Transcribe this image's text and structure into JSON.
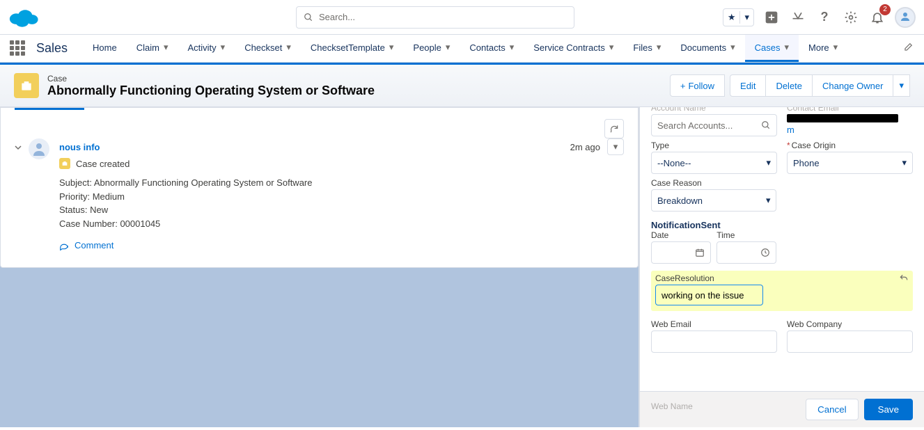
{
  "header": {
    "search_placeholder": "Search...",
    "notification_count": "2"
  },
  "nav": {
    "app_name": "Sales",
    "items": [
      "Home",
      "Claim",
      "Activity",
      "Checkset",
      "ChecksetTemplate",
      "People",
      "Contacts",
      "Service Contracts",
      "Files",
      "Documents",
      "Cases",
      "More"
    ],
    "active_index": 10
  },
  "page": {
    "record_type": "Case",
    "title": "Abnormally Functioning Operating System or Software",
    "actions": {
      "follow": "Follow",
      "edit": "Edit",
      "delete": "Delete",
      "change_owner": "Change Owner"
    }
  },
  "feed": {
    "user": "nous info",
    "time": "2m ago",
    "event": "Case created",
    "subject_label": "Subject:",
    "subject": "Abnormally Functioning Operating System or Software",
    "priority_label": "Priority:",
    "priority": "Medium",
    "status_label": "Status:",
    "status": "New",
    "casenum_label": "Case Number:",
    "casenum": "00001045",
    "comment": "Comment"
  },
  "form": {
    "account_label": "Account Name",
    "account_placeholder": "Search Accounts...",
    "contact_label": "Contact Email",
    "contact_value_suffix": "m",
    "type_label": "Type",
    "type_value": "--None--",
    "origin_label": "Case Origin",
    "origin_value": "Phone",
    "reason_label": "Case Reason",
    "reason_value": "Breakdown",
    "notif_label": "NotificationSent",
    "date_label": "Date",
    "time_label": "Time",
    "resolution_label": "CaseResolution",
    "resolution_value": "working on the issue",
    "webemail_label": "Web Email",
    "webcompany_label": "Web Company",
    "webname_label": "Web Name",
    "cancel": "Cancel",
    "save": "Save"
  }
}
